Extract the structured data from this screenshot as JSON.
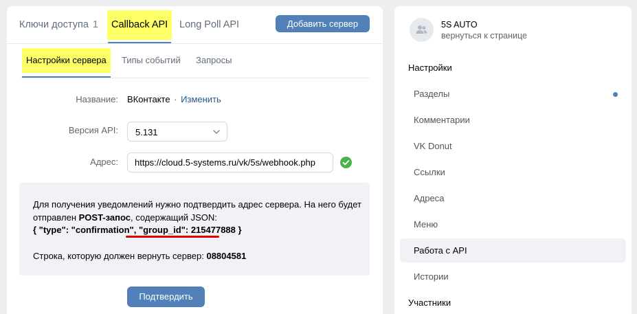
{
  "main_tabs": [
    {
      "label": "Ключи доступа",
      "count": "1"
    },
    {
      "label": "Callback API"
    },
    {
      "label": "Long Poll API"
    }
  ],
  "add_server_label": "Добавить сервер",
  "sub_tabs": [
    {
      "label": "Настройки сервера"
    },
    {
      "label": "Типы событий"
    },
    {
      "label": "Запросы"
    }
  ],
  "form": {
    "name_label": "Название:",
    "name_value": "ВКонтакте",
    "name_sep": "·",
    "name_edit": "Изменить",
    "version_label": "Версия API:",
    "version_value": "5.131",
    "address_label": "Адрес:",
    "address_value": "https://cloud.5-systems.ru/vk/5s/webhook.php"
  },
  "info": {
    "text1": "Для получения уведомлений нужно подтвердить адрес сервера. На него будет отправлен ",
    "text_bold": "POST-запос",
    "text2": ", содержащий JSON:",
    "json_line": "{ \"type\": \"confirmation\", \"group_id\": 215477888 }",
    "return_label": "Строка, которую должен вернуть сервер: ",
    "return_value": "08804581"
  },
  "confirm_label": "Подтвердить",
  "community": {
    "name": "5S AUTO",
    "back": "вернуться к странице"
  },
  "menu": {
    "settings_title": "Настройки",
    "items": [
      "Разделы",
      "Комментарии",
      "VK Donut",
      "Ссылки",
      "Адреса",
      "Меню",
      "Работа с API",
      "Истории"
    ],
    "participants_title": "Участники"
  },
  "colors": {
    "accent": "#5181b8",
    "highlight": "#fcff65",
    "success": "#4bb34b",
    "annotation_red": "#e00000"
  }
}
